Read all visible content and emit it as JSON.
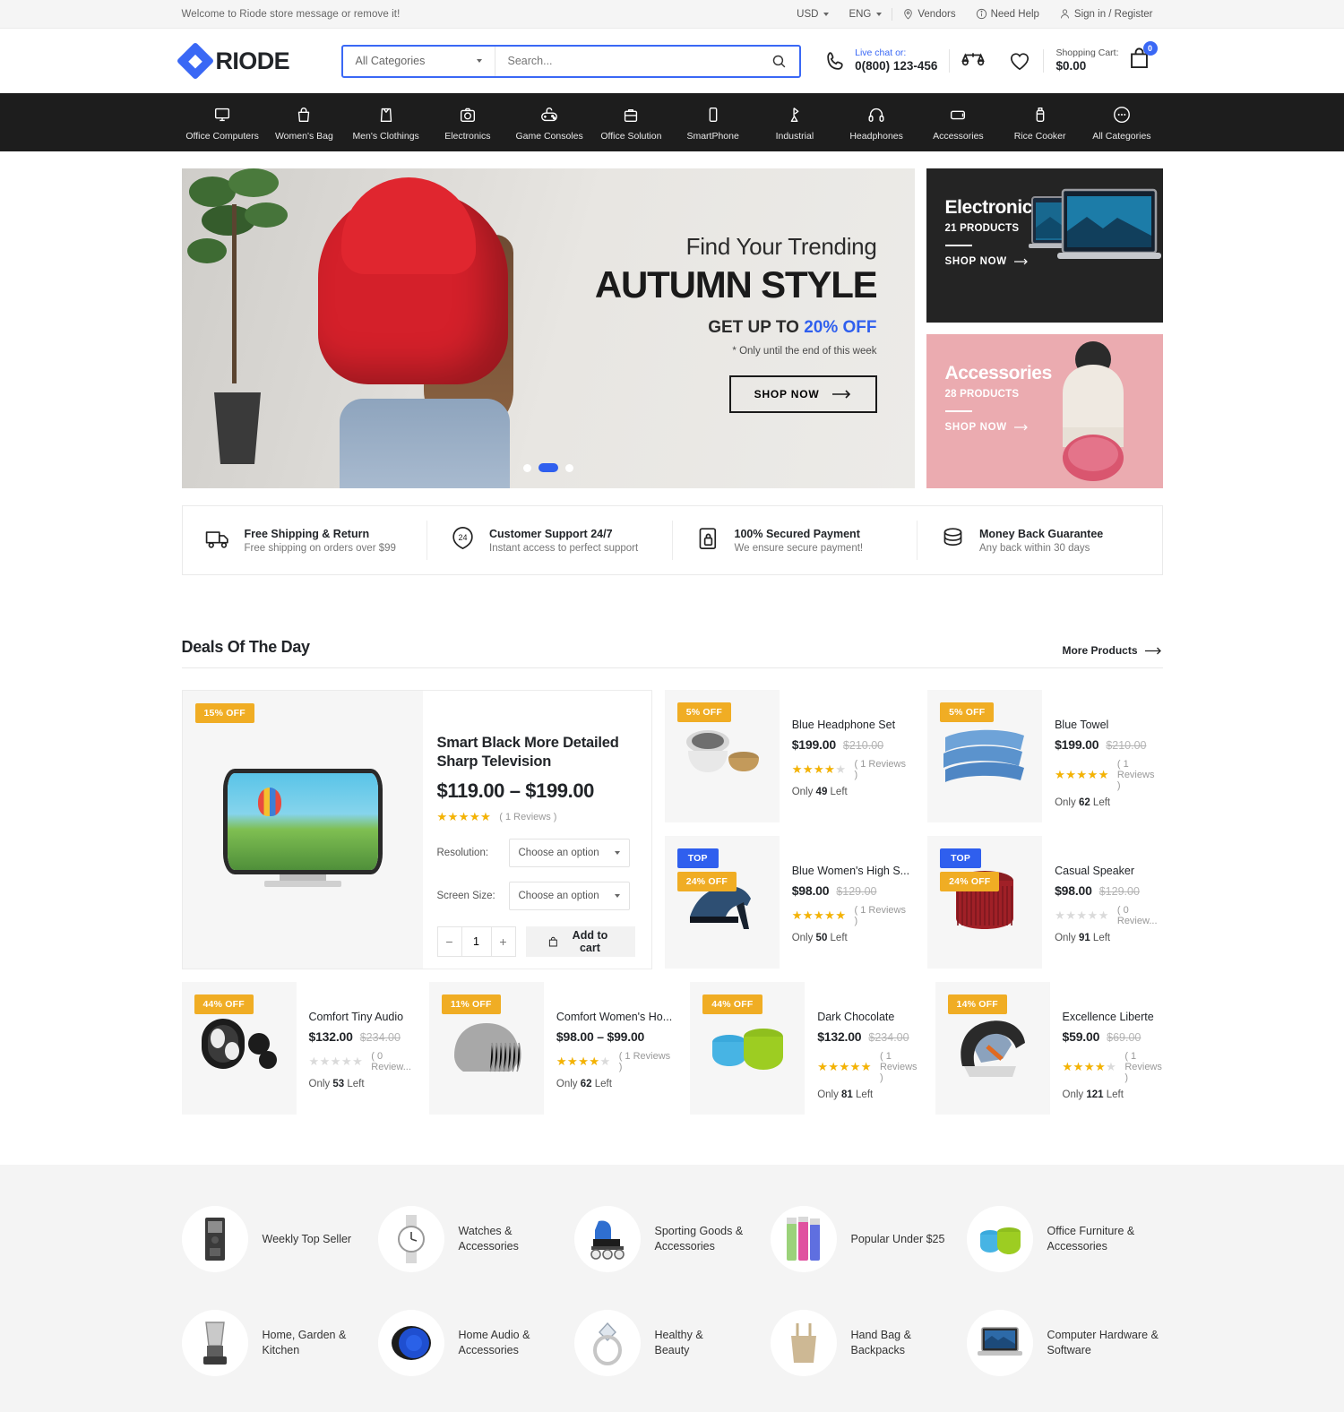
{
  "topbar": {
    "message": "Welcome to Riode store message or remove it!",
    "currency": "USD",
    "language": "ENG",
    "vendors": "Vendors",
    "need_help": "Need Help",
    "account": "Sign in / Register"
  },
  "header": {
    "logo_text": "RIODE",
    "search": {
      "category": "All Categories",
      "placeholder": "Search...",
      "value": ""
    },
    "livechat_label": "Live chat or:",
    "phone": "0(800) 123-456",
    "cart_label": "Shopping Cart:",
    "cart_total": "$0.00",
    "cart_count": "0"
  },
  "nav": {
    "items": [
      {
        "label": "Office Computers",
        "icon": "monitor-icon"
      },
      {
        "label": "Women's Bag",
        "icon": "handbag-icon"
      },
      {
        "label": "Men's Clothings",
        "icon": "shirt-icon"
      },
      {
        "label": "Electronics",
        "icon": "camera-icon"
      },
      {
        "label": "Game Consoles",
        "icon": "gamepad-icon"
      },
      {
        "label": "Office Solution",
        "icon": "briefcase-icon"
      },
      {
        "label": "SmartPhone",
        "icon": "phone-icon"
      },
      {
        "label": "Industrial",
        "icon": "crane-icon"
      },
      {
        "label": "Headphones",
        "icon": "headphone-icon"
      },
      {
        "label": "Accessories",
        "icon": "watch-icon"
      },
      {
        "label": "Rice Cooker",
        "icon": "bottle-icon"
      },
      {
        "label": "All Categories",
        "icon": "dots-icon"
      }
    ]
  },
  "hero": {
    "line1": "Find Your Trending",
    "line2": "AUTUMN STYLE",
    "line3_pre": "GET UP TO ",
    "line3_em": "20% OFF",
    "line4": "* Only until the end of this week",
    "button": "SHOP NOW",
    "slide_count": 3,
    "active_slide": 2
  },
  "side_banners": [
    {
      "title": "Electronics",
      "count": "21 PRODUCTS",
      "cta": "SHOP NOW",
      "theme": "dark"
    },
    {
      "title": "Accessories",
      "count": "28 PRODUCTS",
      "cta": "SHOP NOW",
      "theme": "pink"
    }
  ],
  "features": [
    {
      "icon": "truck-icon",
      "title": "Free Shipping & Return",
      "sub": "Free shipping on orders over $99"
    },
    {
      "icon": "support-24-icon",
      "title": "Customer Support 24/7",
      "sub": "Instant access to perfect support"
    },
    {
      "icon": "secure-payment-icon",
      "title": "100% Secured Payment",
      "sub": "We ensure secure payment!"
    },
    {
      "icon": "money-back-icon",
      "title": "Money Back Guarantee",
      "sub": "Any back within 30 days"
    }
  ],
  "deals": {
    "title": "Deals Of The Day",
    "more_label": "More Products",
    "featured": {
      "badge": "15% OFF",
      "name": "Smart Black More Detailed Sharp Television",
      "price": "$119.00 – $199.00",
      "rating": 5,
      "reviews": "( 1 Reviews )",
      "options": [
        {
          "label": "Resolution:",
          "value": "Choose an option"
        },
        {
          "label": "Screen Size:",
          "value": "Choose an option"
        }
      ],
      "qty": "1",
      "add_to_cart": "Add to cart"
    },
    "products": [
      {
        "badge": "5% OFF",
        "top": null,
        "name": "Blue Headphone Set",
        "price": "$199.00",
        "old_price": "$210.00",
        "rating": 4,
        "reviews": "( 1 Reviews )",
        "stock_pre": "Only ",
        "stock_num": "49",
        "stock_post": " Left",
        "img": "rice-cooker"
      },
      {
        "badge": "5% OFF",
        "top": null,
        "name": "Blue Towel",
        "price": "$199.00",
        "old_price": "$210.00",
        "rating": 5,
        "reviews": "( 1 Reviews )",
        "stock_pre": "Only ",
        "stock_num": "62",
        "stock_post": " Left",
        "img": "towel"
      },
      {
        "badge": "24% OFF",
        "top": "TOP",
        "name": "Blue Women's High S...",
        "price": "$98.00",
        "old_price": "$129.00",
        "rating": 5,
        "reviews": "( 1 Reviews )",
        "stock_pre": "Only ",
        "stock_num": "50",
        "stock_post": " Left",
        "img": "heel"
      },
      {
        "badge": "24% OFF",
        "top": "TOP",
        "name": "Casual Speaker",
        "price": "$98.00",
        "old_price": "$129.00",
        "rating": 0,
        "reviews": "( 0 Review...",
        "stock_pre": "Only ",
        "stock_num": "91",
        "stock_post": " Left",
        "img": "speaker"
      }
    ],
    "products_bottom": [
      {
        "badge": "44% OFF",
        "top": null,
        "name": "Comfort Tiny Audio",
        "price": "$132.00",
        "old_price": "$234.00",
        "rating": 0,
        "reviews": "( 0 Review...",
        "stock_pre": "Only ",
        "stock_num": "53",
        "stock_post": " Left",
        "img": "earbuds"
      },
      {
        "badge": "11% OFF",
        "top": null,
        "name": "Comfort Women's Ho...",
        "price": "$98.00 – $99.00",
        "old_price": "",
        "rating": 4,
        "reviews": "( 1 Reviews )",
        "stock_pre": "Only ",
        "stock_num": "62",
        "stock_post": " Left",
        "img": "beanie"
      },
      {
        "badge": "44% OFF",
        "top": null,
        "name": "Dark Chocolate",
        "price": "$132.00",
        "old_price": "$234.00",
        "rating": 5,
        "reviews": "( 1 Reviews )",
        "stock_pre": "Only ",
        "stock_num": "81",
        "stock_post": " Left",
        "img": "mugs"
      },
      {
        "badge": "14% OFF",
        "top": null,
        "name": "Excellence Liberte",
        "price": "$59.00",
        "old_price": "$69.00",
        "rating": 4,
        "reviews": "( 1 Reviews )",
        "stock_pre": "Only ",
        "stock_num": "121",
        "stock_post": " Left",
        "img": "carseat"
      }
    ]
  },
  "foot_categories": [
    {
      "label": "Weekly Top Seller",
      "icon": "recorder-icon"
    },
    {
      "label": "Watches & Accessories",
      "icon": "watch-icon"
    },
    {
      "label": "Sporting Goods & Accessories",
      "icon": "rollerblade-icon"
    },
    {
      "label": "Popular Under $25",
      "icon": "cosmetics-icon"
    },
    {
      "label": "Office Furniture & Accessories",
      "icon": "mugs-icon"
    },
    {
      "label": "Home, Garden & Kitchen",
      "icon": "blender-icon"
    },
    {
      "label": "Home Audio & Accessories",
      "icon": "speaker-icon"
    },
    {
      "label": "Healthy & Beauty",
      "icon": "ring-icon"
    },
    {
      "label": "Hand Bag & Backpacks",
      "icon": "handbag-icon"
    },
    {
      "label": "Computer Hardware & Software",
      "icon": "laptop-icon"
    }
  ],
  "colors": {
    "accent": "#3a68f5",
    "badge": "#f0ad24",
    "top_badge": "#2f5fee",
    "star": "#f5b301",
    "nav_bg": "#1d1d1d"
  }
}
